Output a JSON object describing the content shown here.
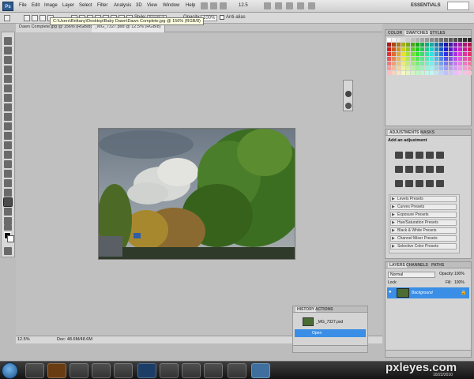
{
  "menubar": {
    "app_icon": "Ps",
    "items": [
      "File",
      "Edit",
      "Image",
      "Layer",
      "Select",
      "Filter",
      "Analysis",
      "3D",
      "View",
      "Window",
      "Help"
    ],
    "zoom": "12.5",
    "workspace": "ESSENTIALS"
  },
  "options": {
    "tooltip": "C:\\Users\\Brittany\\Desktop\\Baby Dawn\\Dawn Complete.jpg @ 156% (RGB/8)",
    "style_label": "Style:",
    "style_value": "Normal",
    "opacity_label": "Opacity:",
    "opacity_value": "100%",
    "antialias_label": "Anti-alias"
  },
  "document_tabs": [
    {
      "label": "Dawn Complete.jpg @ 156% (RGB/8)",
      "active": false
    },
    {
      "label": "_MG_7327.psd @ 12.5% (RGB/8)",
      "active": true
    }
  ],
  "status": {
    "zoom": "12.5%",
    "doc": "Doc: 48.6M/48.6M"
  },
  "color_panel": {
    "tabs": [
      "COLOR",
      "SWATCHES",
      "STYLES"
    ],
    "active_tab": "SWATCHES"
  },
  "adjustments_panel": {
    "tabs": [
      "ADJUSTMENTS",
      "MASKS"
    ],
    "active_tab": "ADJUSTMENTS",
    "heading": "Add an adjustment",
    "presets": [
      "Levels Presets",
      "Curves Presets",
      "Exposure Presets",
      "Hue/Saturation Presets",
      "Black & White Presets",
      "Channel Mixer Presets",
      "Selective Color Presets"
    ]
  },
  "layers_panel": {
    "tabs": [
      "LAYERS",
      "CHANNELS",
      "PATHS"
    ],
    "active_tab": "LAYERS",
    "blend_mode": "Normal",
    "opacity_label": "Opacity:",
    "opacity_value": "100%",
    "lock_label": "Lock:",
    "fill_label": "Fill:",
    "fill_value": "100%",
    "layers": [
      {
        "name": "Background",
        "selected": true
      }
    ]
  },
  "history_panel": {
    "tabs": [
      "HISTORY",
      "ACTIONS"
    ],
    "active_tab": "HISTORY",
    "snapshot": "_MG_7327.psd",
    "states": [
      {
        "name": "Open",
        "selected": true
      }
    ]
  },
  "taskbar": {
    "apps": [
      "hp",
      "Bridge",
      "Explorer",
      "IE",
      "Media",
      "Photoshop",
      "Folder",
      "Chrome",
      "Windows",
      "Snipping",
      "App"
    ],
    "time": "",
    "date": "10/22/2010"
  },
  "watermark": {
    "text": "pxleyes.com"
  },
  "colors": {
    "layer_selected": "#3a8ee6",
    "swatch_panel_bg": "#d4d4d4",
    "taskbar": "#1e1e1e"
  }
}
